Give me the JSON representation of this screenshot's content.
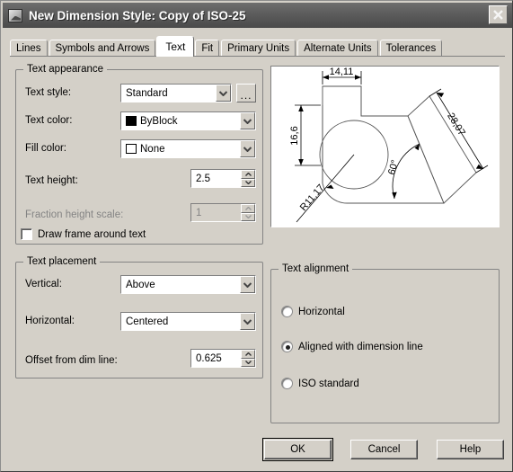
{
  "window": {
    "title": "New Dimension Style: Copy of ISO-25",
    "icon": "dimension-style-icon",
    "close_label": "close-icon"
  },
  "tabs": [
    {
      "label": "Lines",
      "active": false
    },
    {
      "label": "Symbols and Arrows",
      "active": false
    },
    {
      "label": "Text",
      "active": true
    },
    {
      "label": "Fit",
      "active": false
    },
    {
      "label": "Primary Units",
      "active": false
    },
    {
      "label": "Alternate Units",
      "active": false
    },
    {
      "label": "Tolerances",
      "active": false
    }
  ],
  "text_appearance": {
    "legend": "Text appearance",
    "text_style": {
      "label": "Text style:",
      "value": "Standard",
      "browse_label": "..."
    },
    "text_color": {
      "label": "Text color:",
      "value": "ByBlock",
      "swatch": "#000000"
    },
    "fill_color": {
      "label": "Fill color:",
      "value": "None",
      "swatch": "#ffffff"
    },
    "text_height": {
      "label": "Text height:",
      "value": "2.5"
    },
    "fraction_height_scale": {
      "label": "Fraction height scale:",
      "value": "1",
      "disabled": true
    },
    "draw_frame": {
      "label": "Draw frame around text",
      "checked": false
    }
  },
  "text_placement": {
    "legend": "Text placement",
    "vertical": {
      "label": "Vertical:",
      "value": "Above"
    },
    "horizontal": {
      "label": "Horizontal:",
      "value": "Centered"
    },
    "offset": {
      "label": "Offset from dim line:",
      "value": "0.625"
    }
  },
  "text_alignment": {
    "legend": "Text alignment",
    "options": [
      {
        "label": "Horizontal",
        "selected": false
      },
      {
        "label": "Aligned with dimension line",
        "selected": true
      },
      {
        "label": "ISO standard",
        "selected": false
      }
    ]
  },
  "preview": {
    "name": "dimension-style-preview",
    "dimensions": {
      "width": "14,11",
      "height": "16,6",
      "radius": "R11,17",
      "angle": "60°",
      "diagonal": "28,07"
    }
  },
  "buttons": {
    "ok": "OK",
    "cancel": "Cancel",
    "help": "Help"
  }
}
